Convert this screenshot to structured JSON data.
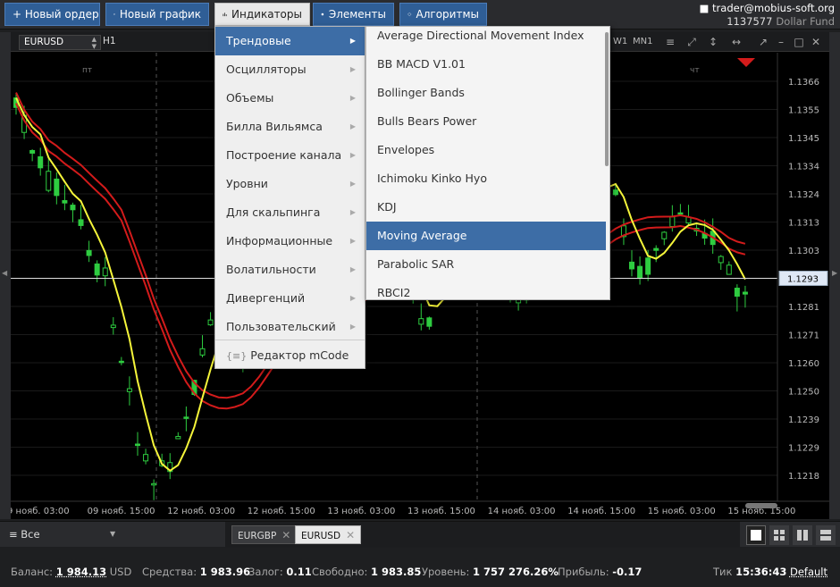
{
  "toolbar": {
    "new_order": "+ Новый ордер",
    "new_chart": "Новый график",
    "indicators": "Индикаторы",
    "elements": "Элементы",
    "algorithms": "Алгоритмы"
  },
  "account": {
    "email": "trader@mobius-soft.org",
    "id": "1137577",
    "fund": "Dollar Fund"
  },
  "chart_header": {
    "symbol": "EURUSD",
    "timeframe": "H1",
    "tf_w1": "W1",
    "tf_mn1": "MN1"
  },
  "indicator_menu": {
    "categories": [
      {
        "label": "Трендовые"
      },
      {
        "label": "Осцилляторы"
      },
      {
        "label": "Объемы"
      },
      {
        "label": "Билла Вильямса"
      },
      {
        "label": "Построение канала"
      },
      {
        "label": "Уровни"
      },
      {
        "label": "Для скальпинга"
      },
      {
        "label": "Информационные"
      },
      {
        "label": "Волатильности"
      },
      {
        "label": "Дивергенций"
      },
      {
        "label": "Пользовательский"
      }
    ],
    "editor_label": "Редактор mCode",
    "selected_category": "Трендовые"
  },
  "trend_submenu": {
    "items": [
      {
        "label": "Average Directional Movement Index"
      },
      {
        "label": "BB MACD V1.01"
      },
      {
        "label": "Bollinger Bands"
      },
      {
        "label": "Bulls Bears Power"
      },
      {
        "label": "Envelopes"
      },
      {
        "label": "Ichimoku Kinko Hyo"
      },
      {
        "label": "KDJ"
      },
      {
        "label": "Moving Average"
      },
      {
        "label": "Parabolic SAR"
      },
      {
        "label": "RBCI2"
      }
    ],
    "selected_item": "Moving Average"
  },
  "chart": {
    "day_labels": [
      "пт",
      "чт"
    ],
    "price_ticks": [
      "1.1366",
      "1.1355",
      "1.1345",
      "1.1334",
      "1.1324",
      "1.1313",
      "1.1303",
      "1.1293",
      "1.1281",
      "1.1271",
      "1.1260",
      "1.1250",
      "1.1239",
      "1.1229",
      "1.1218"
    ],
    "current_price": "1.1293",
    "time_ticks": [
      "9 нояб. 03:00",
      "09 нояб. 15:00",
      "12 нояб. 03:00",
      "12 нояб. 15:00",
      "13 нояб. 03:00",
      "13 нояб. 15:00",
      "14 нояб. 03:00",
      "14 нояб. 15:00",
      "15 нояб. 03:00",
      "15 нояб. 15:00"
    ],
    "up_color": "#2ecc40",
    "ma_fast_color": "#f5f53a",
    "ma_slow_color": "#d31b1b"
  },
  "tabs": {
    "filter_label": "Все",
    "symbols": [
      {
        "label": "EURGBP",
        "active": false
      },
      {
        "label": "EURUSD",
        "active": true
      }
    ]
  },
  "status": {
    "balance_label": "Баланс:",
    "balance_value": "1 984.13",
    "balance_ccy": "USD",
    "equity_label": "Средства:",
    "equity_value": "1 983.96",
    "margin_label": "Залог:",
    "margin_value": "0.11",
    "free_label": "Свободно:",
    "free_value": "1 983.85",
    "level_label": "Уровень:",
    "level_value": "1 757 276.26%",
    "profit_label": "Прибыль:",
    "profit_value": "-0.17",
    "tick_label": "Тик",
    "tick_time": "15:36:43",
    "default_label": "Default"
  }
}
